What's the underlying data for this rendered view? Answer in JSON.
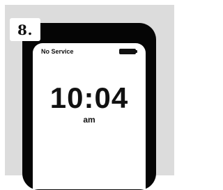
{
  "step": {
    "number_label": "8."
  },
  "phone": {
    "status_bar": {
      "carrier_text": "No Service",
      "battery_icon": "battery-full-icon"
    },
    "lock_screen": {
      "time": "10:04",
      "meridiem": "am"
    }
  },
  "colors": {
    "panel_background": "#dcdcdc",
    "phone_body": "#050505",
    "screen": "#ffffff",
    "text": "#111111"
  }
}
